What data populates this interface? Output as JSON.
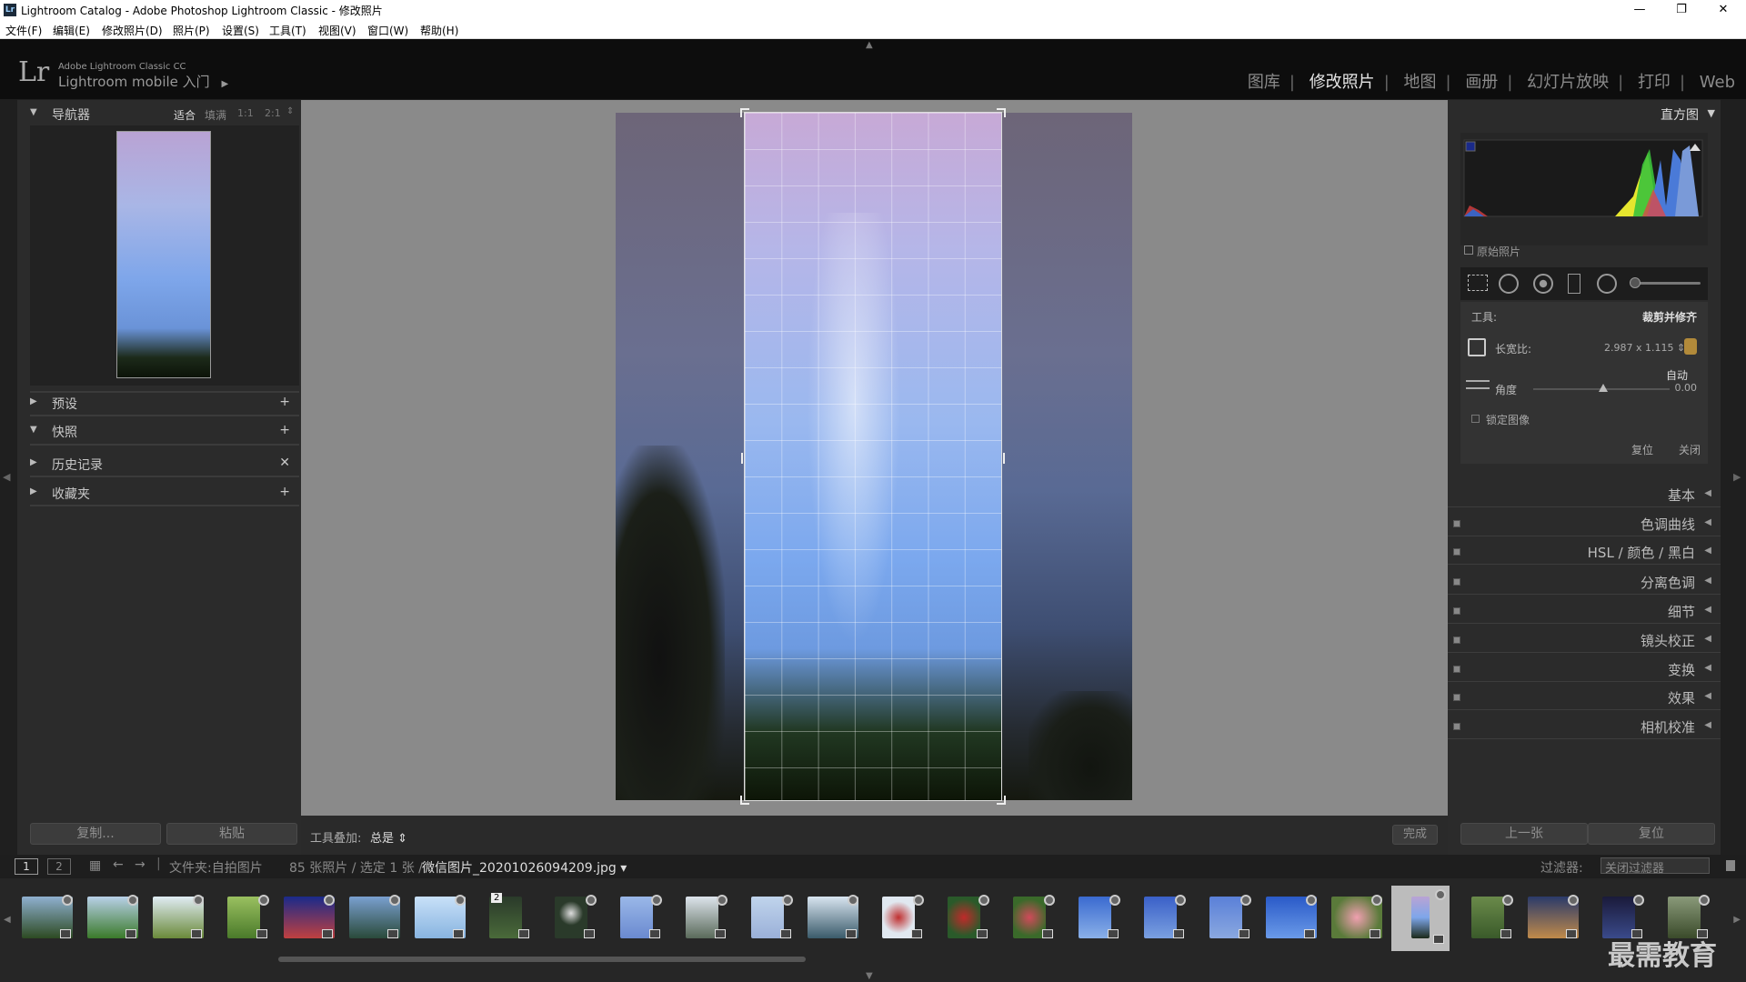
{
  "window": {
    "title": "Lightroom Catalog - Adobe Photoshop Lightroom Classic - 修改照片",
    "minimize": "—",
    "restore": "❐",
    "close": "✕"
  },
  "menu": [
    "文件(F)",
    "编辑(E)",
    "修改照片(D)",
    "照片(P)",
    "设置(S)",
    "工具(T)",
    "视图(V)",
    "窗口(W)",
    "帮助(H)"
  ],
  "identity": {
    "logo": "Lr",
    "line1": "Adobe Lightroom Classic CC",
    "line2": "Lightroom mobile 入门",
    "arrow": "▶"
  },
  "modules": [
    "图库",
    "修改照片",
    "地图",
    "画册",
    "幻灯片放映",
    "打印",
    "Web"
  ],
  "left": {
    "navigator": {
      "title": "导航器",
      "zoom": [
        "适合",
        "填满",
        "1:1",
        "2:1"
      ]
    },
    "presets": "预设",
    "snapshots": "快照",
    "history": "历史记录",
    "collections": "收藏夹",
    "copy_btn": "复制...",
    "paste_btn": "粘贴"
  },
  "right": {
    "histogram_title": "直方图",
    "original_photo": "原始照片",
    "tool_label": "工具:",
    "tool_name": "裁剪并修齐",
    "aspect_label": "长宽比:",
    "aspect_value": "2.987 x 1.115",
    "auto": "自动",
    "angle_label": "角度",
    "angle_value": "0.00",
    "lock_image": "锁定图像",
    "reset": "复位",
    "close": "关闭",
    "sections": [
      "基本",
      "色调曲线",
      "HSL / 颜色 / 黑白",
      "分离色调",
      "细节",
      "镜头校正",
      "变换",
      "效果",
      "相机校准"
    ],
    "prev_btn": "上一张",
    "reset_btn": "复位"
  },
  "toolbar": {
    "overlay_label": "工具叠加:",
    "overlay_value": "总是",
    "done": "完成"
  },
  "filmstrip": {
    "page1": "1",
    "page2": "2",
    "path": "文件夹:自拍图片",
    "count": "85 张照片 / 选定 1 张 /",
    "filename": "微信图片_20201026094209.jpg",
    "filter_label": "过滤器:",
    "filter_value": "关闭过滤器",
    "stack_count": "2"
  },
  "watermark": "最需教育",
  "colors": {
    "accent": "#e6e6e6",
    "panel": "#2b2b2b",
    "crop_bg": "#8a8a8a"
  }
}
